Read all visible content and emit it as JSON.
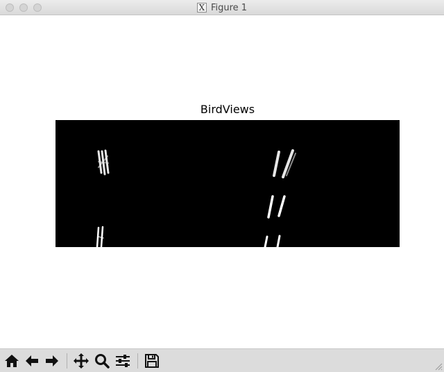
{
  "window": {
    "title": "Figure 1"
  },
  "figure": {
    "axes_title": "BirdViews"
  },
  "toolbar": {
    "buttons": [
      {
        "icon": "home-icon",
        "tooltip": "Home"
      },
      {
        "icon": "back-arrow-icon",
        "tooltip": "Back"
      },
      {
        "icon": "forward-arrow-icon",
        "tooltip": "Forward"
      },
      {
        "icon": "pan-move-icon",
        "tooltip": "Pan"
      },
      {
        "icon": "zoom-magnifier-icon",
        "tooltip": "Zoom"
      },
      {
        "icon": "configure-subplots-icon",
        "tooltip": "Configure subplots"
      },
      {
        "icon": "save-floppy-icon",
        "tooltip": "Save"
      }
    ]
  },
  "colors": {
    "image_background": "#000000",
    "lane_marks": "#ffffff",
    "toolbar_bg": "#dcdcdc"
  }
}
